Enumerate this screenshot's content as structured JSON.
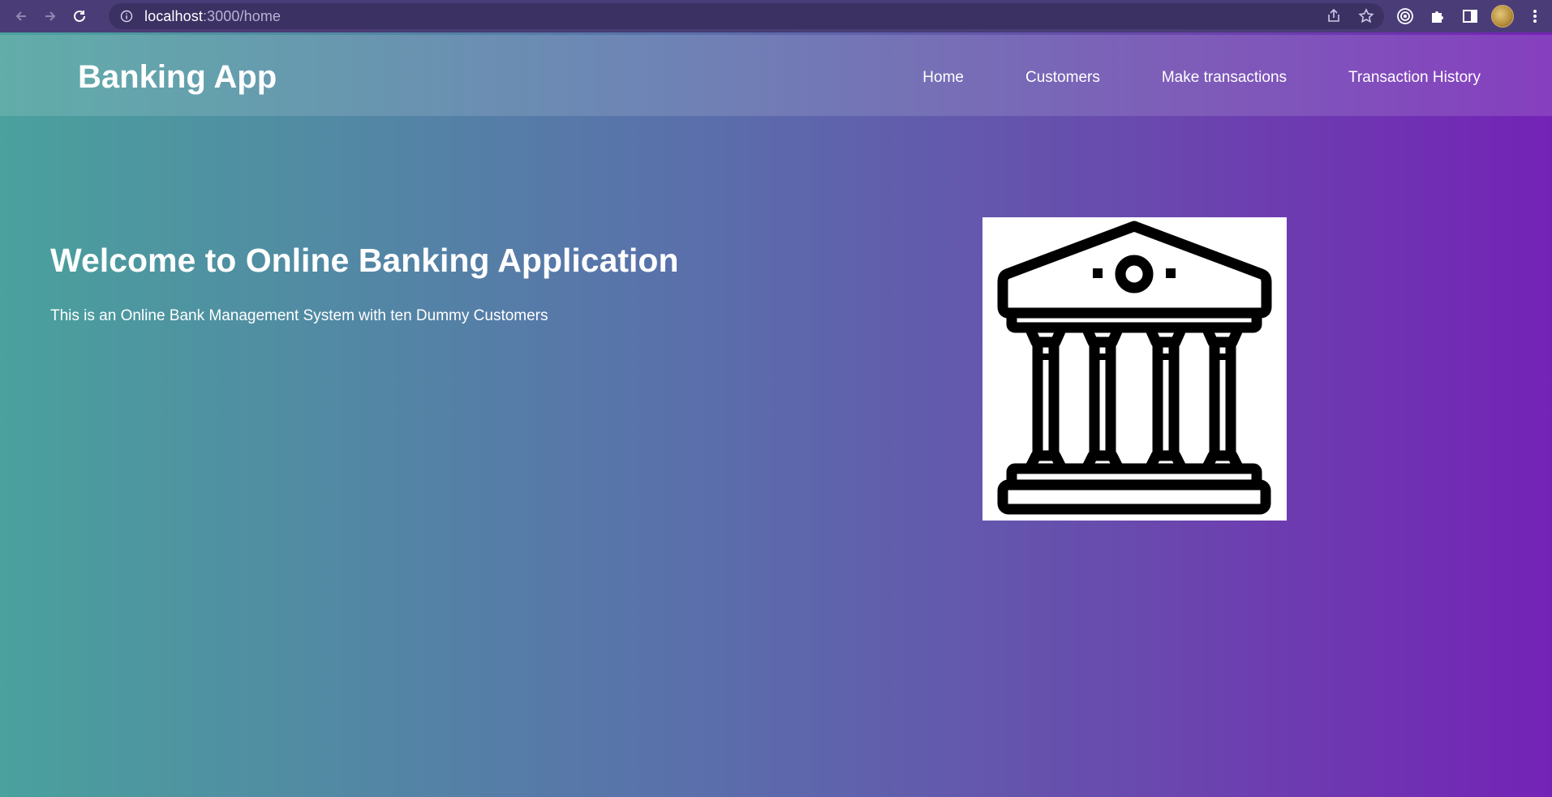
{
  "browser": {
    "url_host": "localhost",
    "url_path": ":3000/home",
    "icons": [
      "back-arrow-icon",
      "forward-arrow-icon",
      "reload-icon",
      "info-icon",
      "share-icon",
      "star-icon",
      "target-icon",
      "puzzle-icon",
      "sidebar-icon",
      "kebab-menu-icon"
    ]
  },
  "navbar": {
    "brand": "Banking App",
    "links": [
      "Home",
      "Customers",
      "Make transactions",
      "Transaction History"
    ]
  },
  "hero": {
    "title": "Welcome to Online Banking Application",
    "subtitle": "This is an Online Bank Management System with ten Dummy Customers",
    "image_icon": "bank-building-icon"
  },
  "colors": {
    "chrome_bg": "#4a3d77",
    "gradient_start": "#4aa19d",
    "gradient_end": "#7423b6",
    "text": "#ffffff"
  }
}
